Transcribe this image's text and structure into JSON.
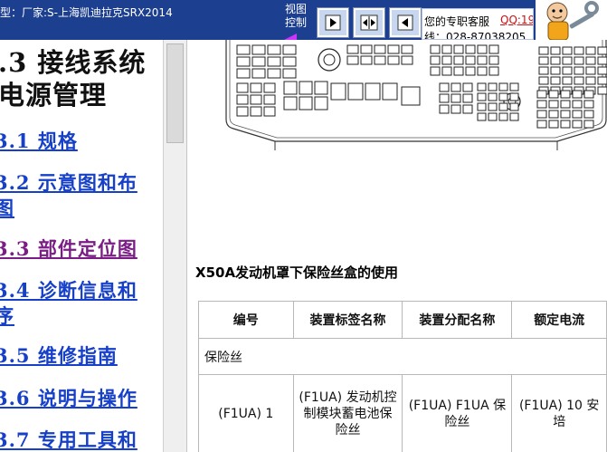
{
  "topbar": {
    "vehicle_info": "型：厂家:S-上海凯迪拉克SRX2014",
    "view_control": [
      "视图",
      "控制"
    ],
    "nav_buttons": [
      {
        "name": "next-page-button",
        "icon": "triangle-right-icon"
      },
      {
        "name": "split-view-button",
        "icon": "split-arrows-icon"
      },
      {
        "name": "previous-page-button",
        "icon": "triangle-left-icon"
      }
    ],
    "support": {
      "label": "您的专职客服",
      "qq": "QQ:19",
      "phone": "线：028-87038205"
    },
    "mascot_icon": "mechanic-mascot-icon"
  },
  "nav": {
    "heading_lines": [
      ".3 接线系统",
      "电源管理"
    ],
    "links": [
      {
        "text": "3.1 规格",
        "visited": false
      },
      {
        "text": "3.2 示意图和布",
        "visited": false
      },
      {
        "text": "图",
        "visited": false
      },
      {
        "text": "3.3 部件定位图",
        "visited": true
      },
      {
        "text": "3.4 诊断信息和",
        "visited": false
      },
      {
        "text": "序",
        "visited": false
      },
      {
        "text": "3.5 维修指南",
        "visited": false
      },
      {
        "text": "3.6 说明与操作",
        "visited": false
      },
      {
        "text": "3.7 专用工具和",
        "visited": false
      }
    ]
  },
  "content": {
    "section_title": "X50A发动机罩下保险丝盒的使用",
    "table": {
      "headers": [
        "编号",
        "装置标签名称",
        "装置分配名称",
        "额定电流"
      ],
      "group_label": "保险丝",
      "rows": [
        [
          "(F1UA) 1",
          "(F1UA) 发动机控制模块蓄电池保险丝",
          "(F1UA) F1UA 保险丝",
          "(F1UA) 10 安培"
        ]
      ]
    }
  },
  "colors": {
    "topbar_bg": "#1d3f8f",
    "link": "#1640c8",
    "visited_link": "#7a1d84",
    "qq_link": "#d01010"
  }
}
